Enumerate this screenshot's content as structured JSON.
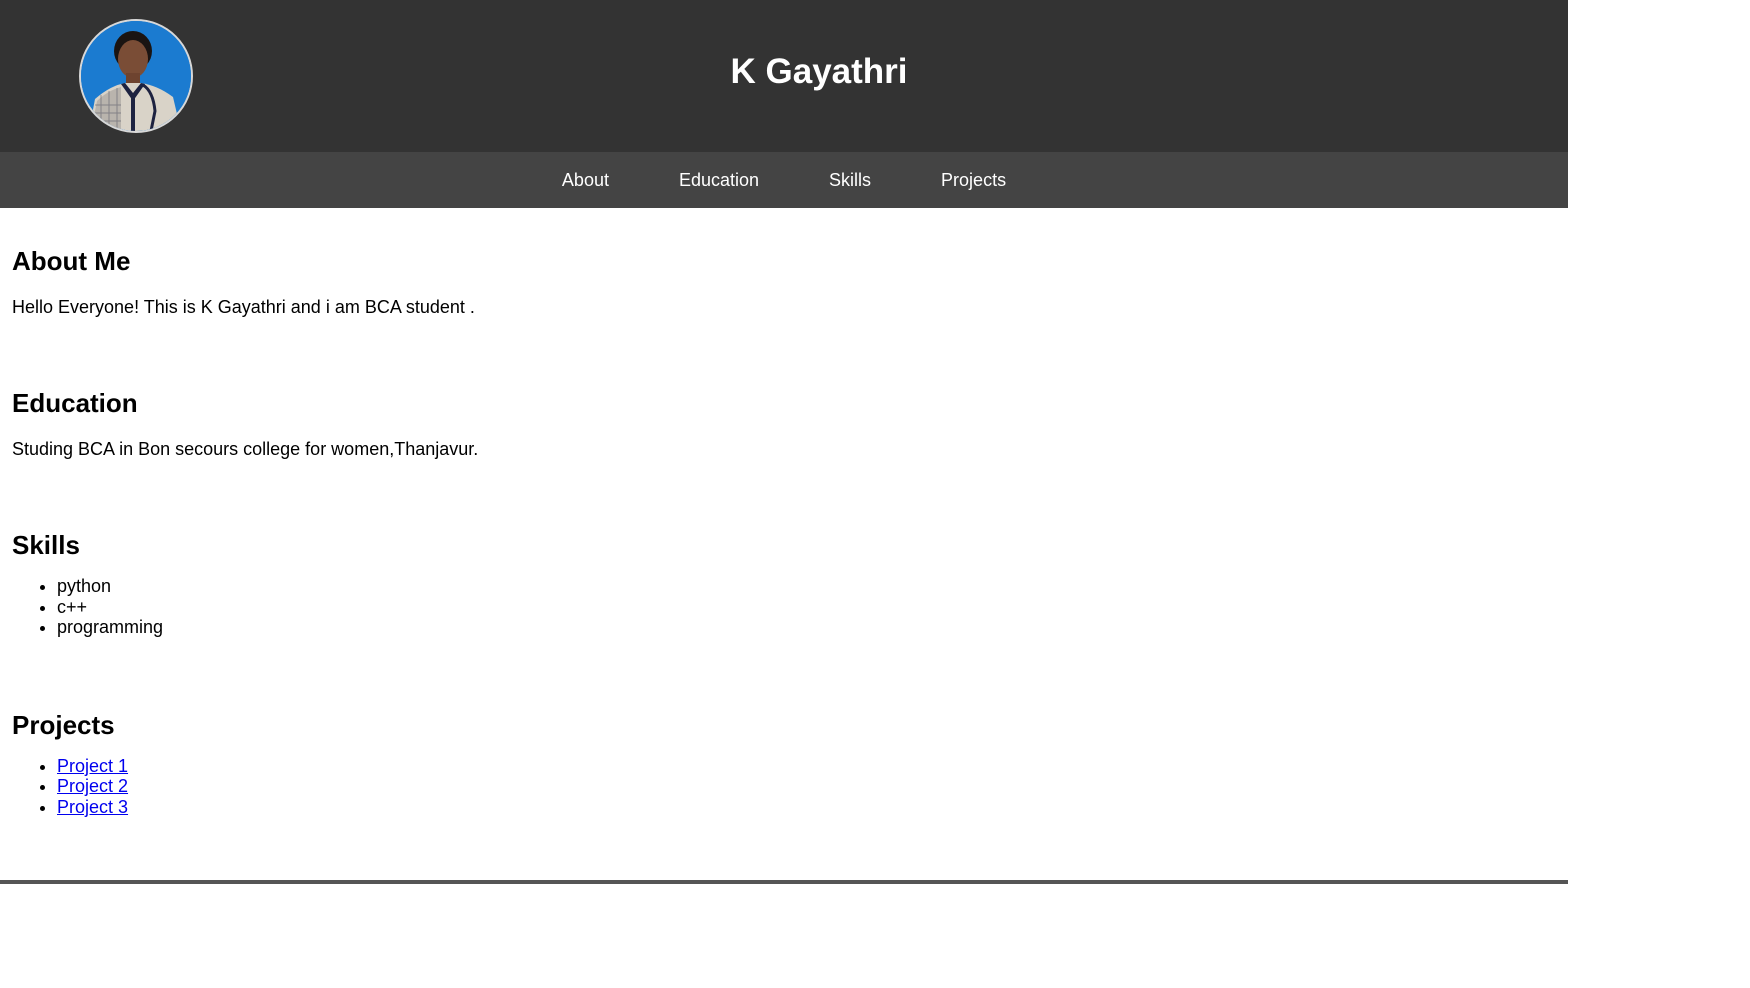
{
  "header": {
    "title": "K Gayathri"
  },
  "nav": {
    "items": [
      {
        "label": "About"
      },
      {
        "label": "Education"
      },
      {
        "label": "Skills"
      },
      {
        "label": "Projects"
      }
    ]
  },
  "about": {
    "heading": "About Me",
    "text": "Hello Everyone! This is K Gayathri and i am BCA student ."
  },
  "education": {
    "heading": "Education",
    "text": "Studing BCA in Bon secours college for women,Thanjavur."
  },
  "skills": {
    "heading": "Skills",
    "items": [
      "python",
      "c++",
      "programming"
    ]
  },
  "projects": {
    "heading": "Projects",
    "items": [
      "Project 1",
      "Project 2",
      "Project 3"
    ]
  },
  "colors": {
    "header_bg": "#333333",
    "nav_bg": "#444444",
    "link": "#0000ee"
  },
  "icons": {
    "avatar": "profile-photo"
  }
}
